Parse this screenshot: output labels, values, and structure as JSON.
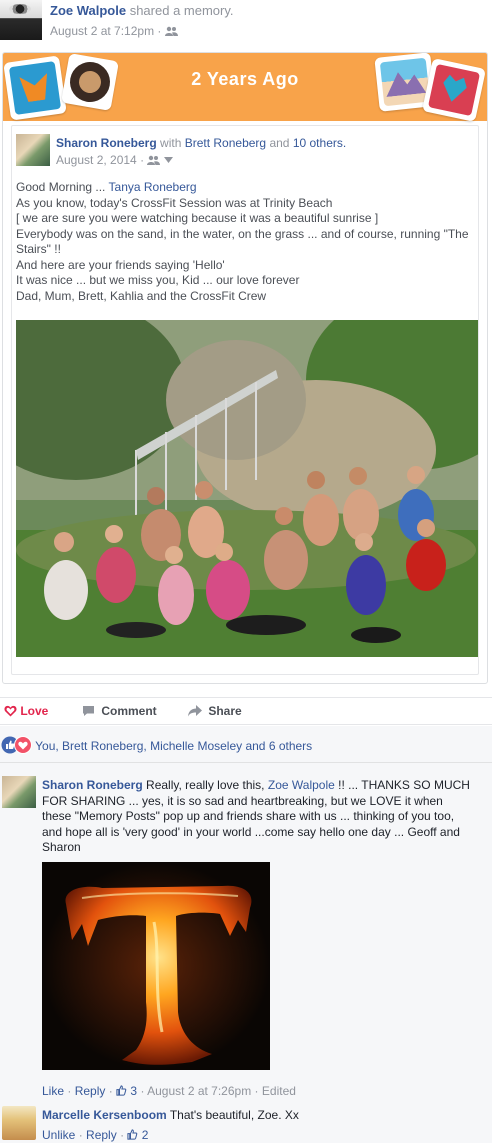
{
  "header": {
    "author": "Zoe Walpole",
    "action": "shared a memory.",
    "time": "August 2 at 7:12pm",
    "separator": "·",
    "audience_icon": "friends-icon"
  },
  "memory": {
    "banner_title": "2 Years Ago",
    "banner_color": "#f8a34a",
    "stickers": [
      "fox-sticker-icon",
      "coffee-sticker-icon",
      "mountain-sticker-icon",
      "heart-sticker-icon"
    ],
    "post": {
      "author": "Sharon Roneberg",
      "with_word": "with",
      "tagged": "Brett Roneberg",
      "and_word": "and",
      "others": "10 others.",
      "date": "August 2, 2014",
      "separator": "·",
      "audience_icon": "friends-icon",
      "body_lines": [
        "Good Morning ...",
        "As you know, today's CrossFit Session was at Trinity Beach",
        "[ we are sure you were watching because it was a beautiful sunrise ]",
        "Everybody was on the sand, in the water, on the grass ... and of course, running \"The",
        "Stairs\" !!",
        "And here are your friends saying 'Hello'",
        "It was nice ... but we miss you, Kid ... our love forever",
        "Dad, Mum, Brett, Kahlia and the CrossFit Crew"
      ],
      "mention": "Tanya Roneberg"
    }
  },
  "actions": {
    "love": "Love",
    "comment": "Comment",
    "share": "Share"
  },
  "reactions": {
    "text": "You, Brett Roneberg, Michelle Moseley and 6 others"
  },
  "comments": [
    {
      "author": "Sharon Roneberg",
      "text_start": "Really, really love this,",
      "mention": "Zoe Walpole",
      "lines": [
        "!! ... THANKS SO MUCH",
        "FOR SHARING ... yes, it is so sad and heartbreaking, but we LOVE it when",
        "these \"Memory Posts\" pop up and friends share with us ... thinking of you too,",
        "and hope all is 'very good' in your world ...come say hello one day ... Geoff and",
        "Sharon"
      ],
      "image_letter": "T",
      "like": "Like",
      "reply": "Reply",
      "likes": "3",
      "time": "August 2 at 7:26pm",
      "edited": "Edited",
      "separator": "·"
    },
    {
      "author": "Marcelle Kersenboom",
      "text": "That's beautiful, Zoe. Xx",
      "unlike": "Unlike",
      "reply": "Reply",
      "likes": "2",
      "separator": "·"
    }
  ]
}
